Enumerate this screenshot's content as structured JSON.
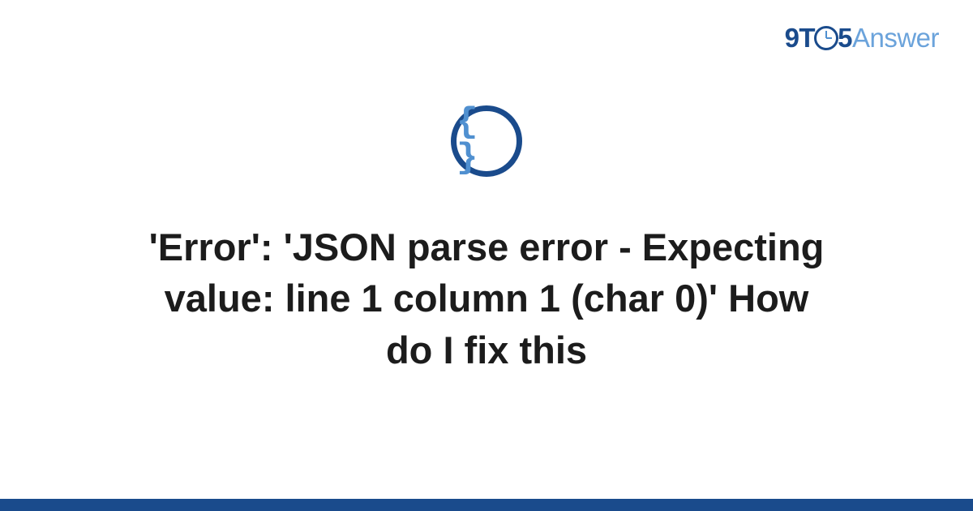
{
  "logo": {
    "nine": "9",
    "t": "T",
    "five": "5",
    "answer": "Answer"
  },
  "icon": {
    "name": "json-braces-icon",
    "glyph": "{ }"
  },
  "title": "'Error': 'JSON parse error - Expecting value: line 1 column 1 (char 0)' How do I fix this",
  "colors": {
    "brand_dark": "#1a4b8c",
    "brand_light": "#6ba3db",
    "accent": "#5090d0"
  }
}
